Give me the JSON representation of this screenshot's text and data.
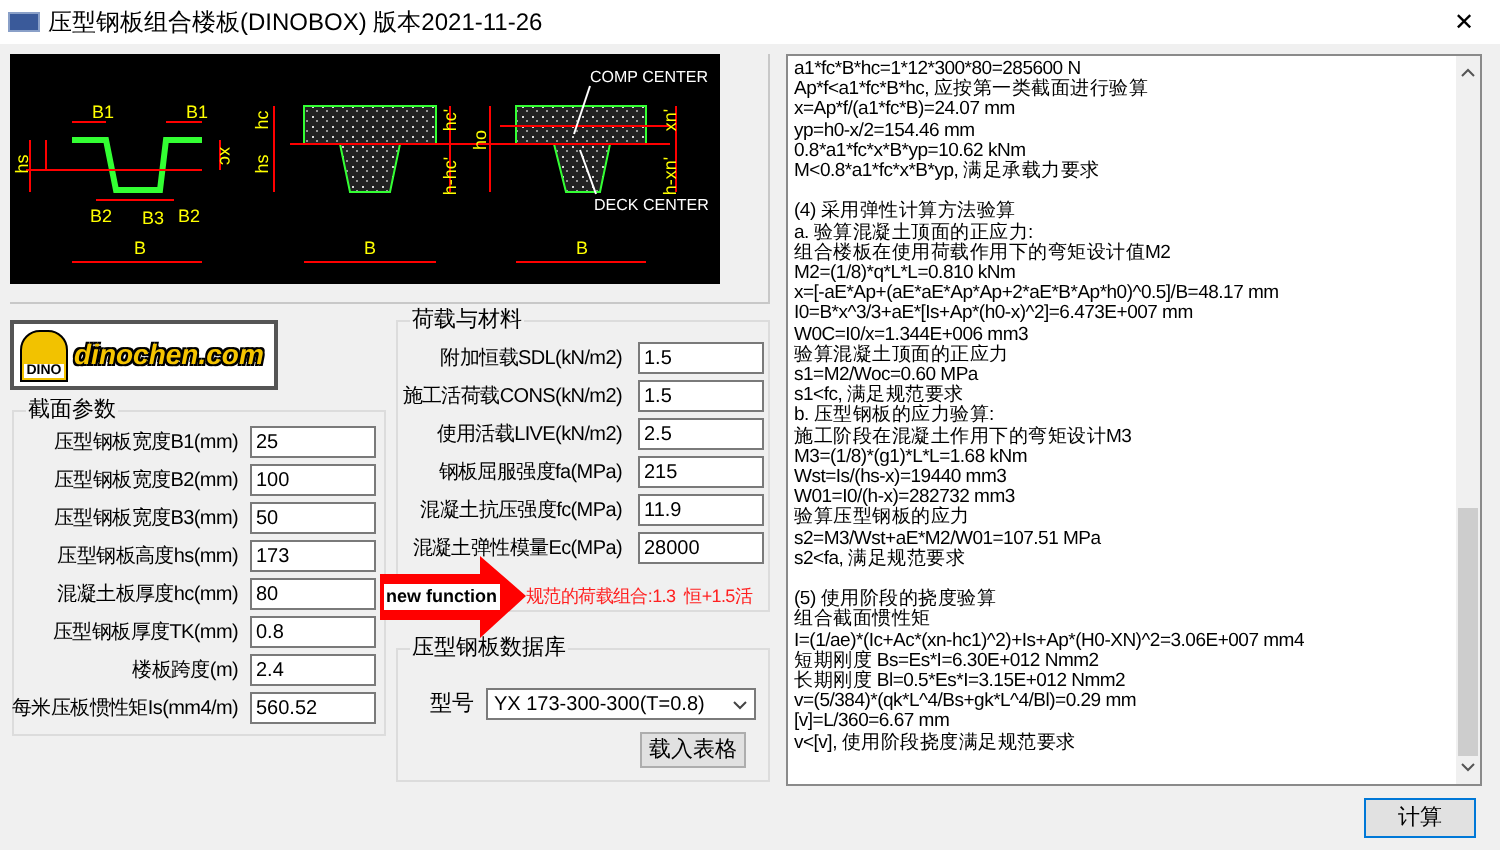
{
  "window": {
    "title": "压型钢板组合楼板(DINOBOX) 版本2021-11-26",
    "close": "✕"
  },
  "diagram": {
    "labels": [
      "B1",
      "B1",
      "hs",
      "xc",
      "B2",
      "B3",
      "B2",
      "B",
      "hc",
      "hs",
      "hc'",
      "h-hc'",
      "B",
      "ho",
      "xn'",
      "h-xn'",
      "B",
      "COMP CENTER",
      "DECK CENTER"
    ]
  },
  "logo": {
    "badge": "DINO",
    "text": "dinochen.com"
  },
  "section_params": {
    "title": "截面参数",
    "fields": [
      {
        "label": "压型钢板宽度B1(mm)",
        "value": "25"
      },
      {
        "label": "压型钢板宽度B2(mm)",
        "value": "100"
      },
      {
        "label": "压型钢板宽度B3(mm)",
        "value": "50"
      },
      {
        "label": "压型钢板高度hs(mm)",
        "value": "173"
      },
      {
        "label": "混凝土板厚度hc(mm)",
        "value": "80"
      },
      {
        "label": "压型钢板厚度TK(mm)",
        "value": "0.8"
      },
      {
        "label": "楼板跨度(m)",
        "value": "2.4"
      },
      {
        "label": "每米压板惯性矩Is(mm4/m)",
        "value": "560.52"
      }
    ]
  },
  "loads": {
    "title": "荷载与材料",
    "fields": [
      {
        "label": "附加恒载SDL(kN/m2)",
        "value": "1.5"
      },
      {
        "label": "施工活荷载CONS(kN/m2)",
        "value": "1.5"
      },
      {
        "label": "使用活载LIVE(kN/m2)",
        "value": "2.5"
      },
      {
        "label": "钢板屈服强度fa(MPa)",
        "value": "215"
      },
      {
        "label": "混凝土抗压强度fc(MPa)",
        "value": "11.9"
      },
      {
        "label": "混凝土弹性模量Ec(MPa)",
        "value": "28000"
      }
    ],
    "note": "规范的荷载组合:1.3  恒+1.5活"
  },
  "database": {
    "title": "压型钢板数据库",
    "model_label": "型号",
    "model": "YX 173-300-300(T=0.8)",
    "load_button": "载入表格"
  },
  "annotation": {
    "text": "new function"
  },
  "output": {
    "paragraphs": [
      [
        "a1*fc*B*hc=1*12*300*80=285600 N",
        "Ap*f<a1*fc*B*hc, 应按第一类截面进行验算",
        "x=Ap*f/(a1*fc*B)=24.07 mm",
        "yp=h0-x/2=154.46 mm",
        "0.8*a1*fc*x*B*yp=10.62 kNm",
        "M<0.8*a1*fc*x*B*yp, 满足承载力要求"
      ],
      [
        "(4) 采用弹性计算方法验算",
        "a. 验算混凝土顶面的正应力:",
        "组合楼板在使用荷载作用下的弯矩设计值M2",
        "M2=(1/8)*q*L*L=0.810 kNm",
        "x=[-aE*Ap+(aE*aE*Ap*Ap+2*aE*B*Ap*h0)^0.5]/B=48.17 mm",
        "I0=B*x^3/3+aE*[Is+Ap*(h0-x)^2]=6.473E+007 mm",
        "W0C=I0/x=1.344E+006 mm3",
        "验算混凝土顶面的正应力",
        "s1=M2/Woc=0.60 MPa",
        "s1<fc, 满足规范要求",
        "b. 压型钢板的应力验算:",
        "施工阶段在混凝土作用下的弯矩设计M3",
        "M3=(1/8)*(g1)*L*L=1.68 kNm",
        "Wst=Is/(hs-x)=19440 mm3",
        "W01=I0/(h-x)=282732 mm3",
        "验算压型钢板的应力",
        "s2=M3/Wst+aE*M2/W01=107.51 MPa",
        "s2<fa, 满足规范要求"
      ],
      [
        "(5) 使用阶段的挠度验算",
        "组合截面惯性矩",
        "I=(1/ae)*(Ic+Ac*(xn-hc1)^2)+Is+Ap*(H0-XN)^2=3.06E+007 mm4",
        "短期刚度 Bs=Es*I=6.30E+012 Nmm2",
        "长期刚度 Bl=0.5*Es*I=3.15E+012 Nmm2",
        "v=(5/384)*(qk*L^4/Bs+gk*L^4/Bl)=0.29 mm",
        "[v]=L/360=6.67 mm",
        "v<[v], 使用阶段挠度满足规范要求"
      ]
    ]
  },
  "calc_button": "计算"
}
